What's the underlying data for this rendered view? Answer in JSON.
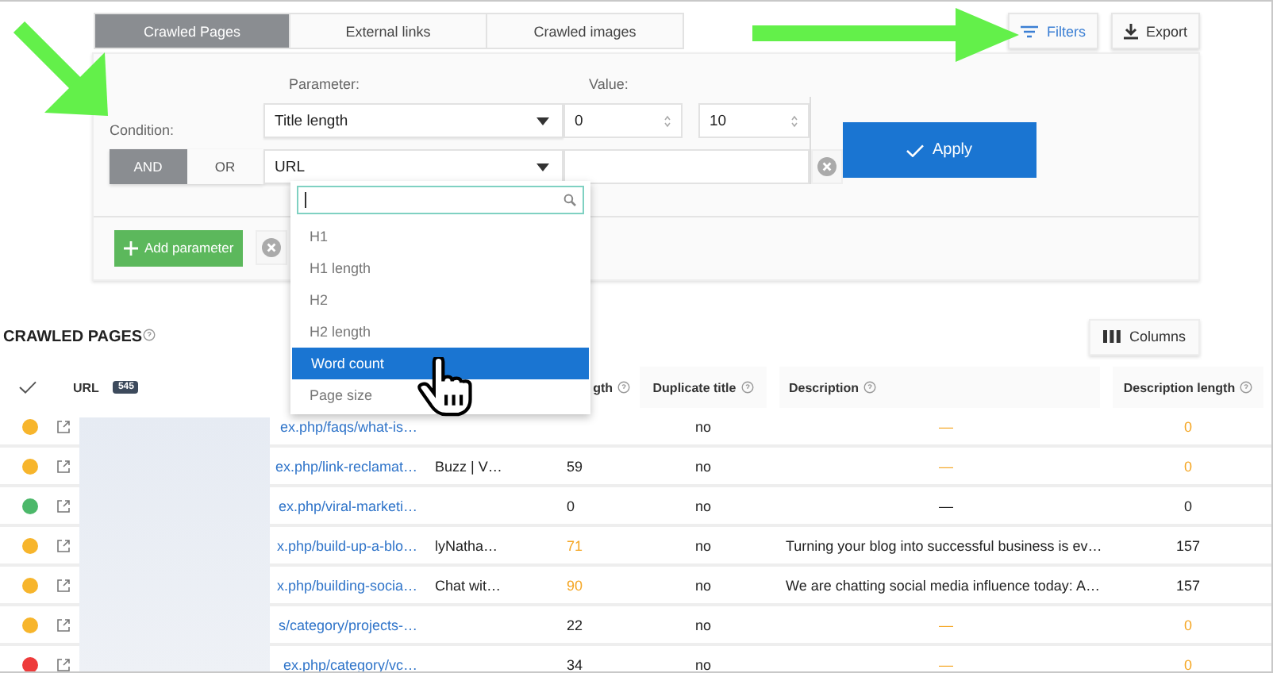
{
  "tabs": [
    {
      "label": "Crawled Pages",
      "selected": true
    },
    {
      "label": "External links",
      "selected": false
    },
    {
      "label": "Crawled images",
      "selected": false
    }
  ],
  "toolbar": {
    "filters": "Filters",
    "export": "Export"
  },
  "filter": {
    "condition_label": "Condition:",
    "conditions": [
      {
        "label": "AND",
        "selected": true
      },
      {
        "label": "OR",
        "selected": false
      }
    ],
    "parameter_label": "Parameter:",
    "value_label": "Value:",
    "rules": [
      {
        "kind": "range",
        "parameter": "Title length",
        "from": "0",
        "to": "10"
      },
      {
        "kind": "text",
        "parameter": "URL"
      }
    ],
    "apply": "Apply",
    "add_parameter": "Add parameter"
  },
  "dropdown": {
    "items": [
      {
        "label": "H1",
        "selected": false
      },
      {
        "label": "H1 length",
        "selected": false
      },
      {
        "label": "H2",
        "selected": false
      },
      {
        "label": "H2 length",
        "selected": false
      },
      {
        "label": "Word count",
        "selected": true
      },
      {
        "label": "Page size",
        "selected": false
      }
    ]
  },
  "section": {
    "title": "CRAWLED PAGES",
    "columns_button": "Columns"
  },
  "table": {
    "columns": [
      {
        "label": "URL",
        "badge": "545"
      },
      {
        "label": "gth"
      },
      {
        "label": "Duplicate title"
      },
      {
        "label": "Description"
      },
      {
        "label": "Description length"
      }
    ],
    "rows": [
      {
        "color": "#f7b52c",
        "url": "ex.php/faqs/what-is…",
        "duplicate_title": "no",
        "description": "—",
        "description_warning": true,
        "description_length": "0",
        "description_length_warning": true
      },
      {
        "color": "#f7b52c",
        "url": "ex.php/link-reclamat…",
        "title": "Buzz | V…",
        "title_length": "59",
        "title_length_warning": false,
        "duplicate_title": "no",
        "description": "—",
        "description_warning": true,
        "description_length": "0",
        "description_length_warning": true
      },
      {
        "color": "#4cb86a",
        "url": "ex.php/viral-marketi…",
        "title_length": "0",
        "title_length_warning": false,
        "duplicate_title": "no",
        "description": "—",
        "description_warning": false,
        "description_length": "0",
        "description_length_warning": false
      },
      {
        "color": "#f7b52c",
        "url": "x.php/build-up-a-blo…",
        "title": "lyNatha…",
        "title_length": "71",
        "title_length_warning": true,
        "duplicate_title": "no",
        "description": "Turning your blog into successful business is ev…",
        "description_warning": false,
        "description_length": "157",
        "description_length_warning": false
      },
      {
        "color": "#f7b52c",
        "url": "x.php/building-socia…",
        "title": "Chat wit…",
        "title_length": "90",
        "title_length_warning": true,
        "duplicate_title": "no",
        "description": "We are chatting social media influence today: A…",
        "description_warning": false,
        "description_length": "157",
        "description_length_warning": false
      },
      {
        "color": "#f7b52c",
        "url": "s/category/projects-…",
        "title_length": "22",
        "title_length_warning": false,
        "duplicate_title": "no",
        "description": "—",
        "description_warning": true,
        "description_length": "0",
        "description_length_warning": true
      },
      {
        "color": "#ee3b3b",
        "url": "ex.php/category/vc…",
        "title_length": "34",
        "title_length_warning": false,
        "duplicate_title": "no",
        "description": "—",
        "description_warning": true,
        "description_length": "0",
        "description_length_warning": true
      }
    ]
  }
}
